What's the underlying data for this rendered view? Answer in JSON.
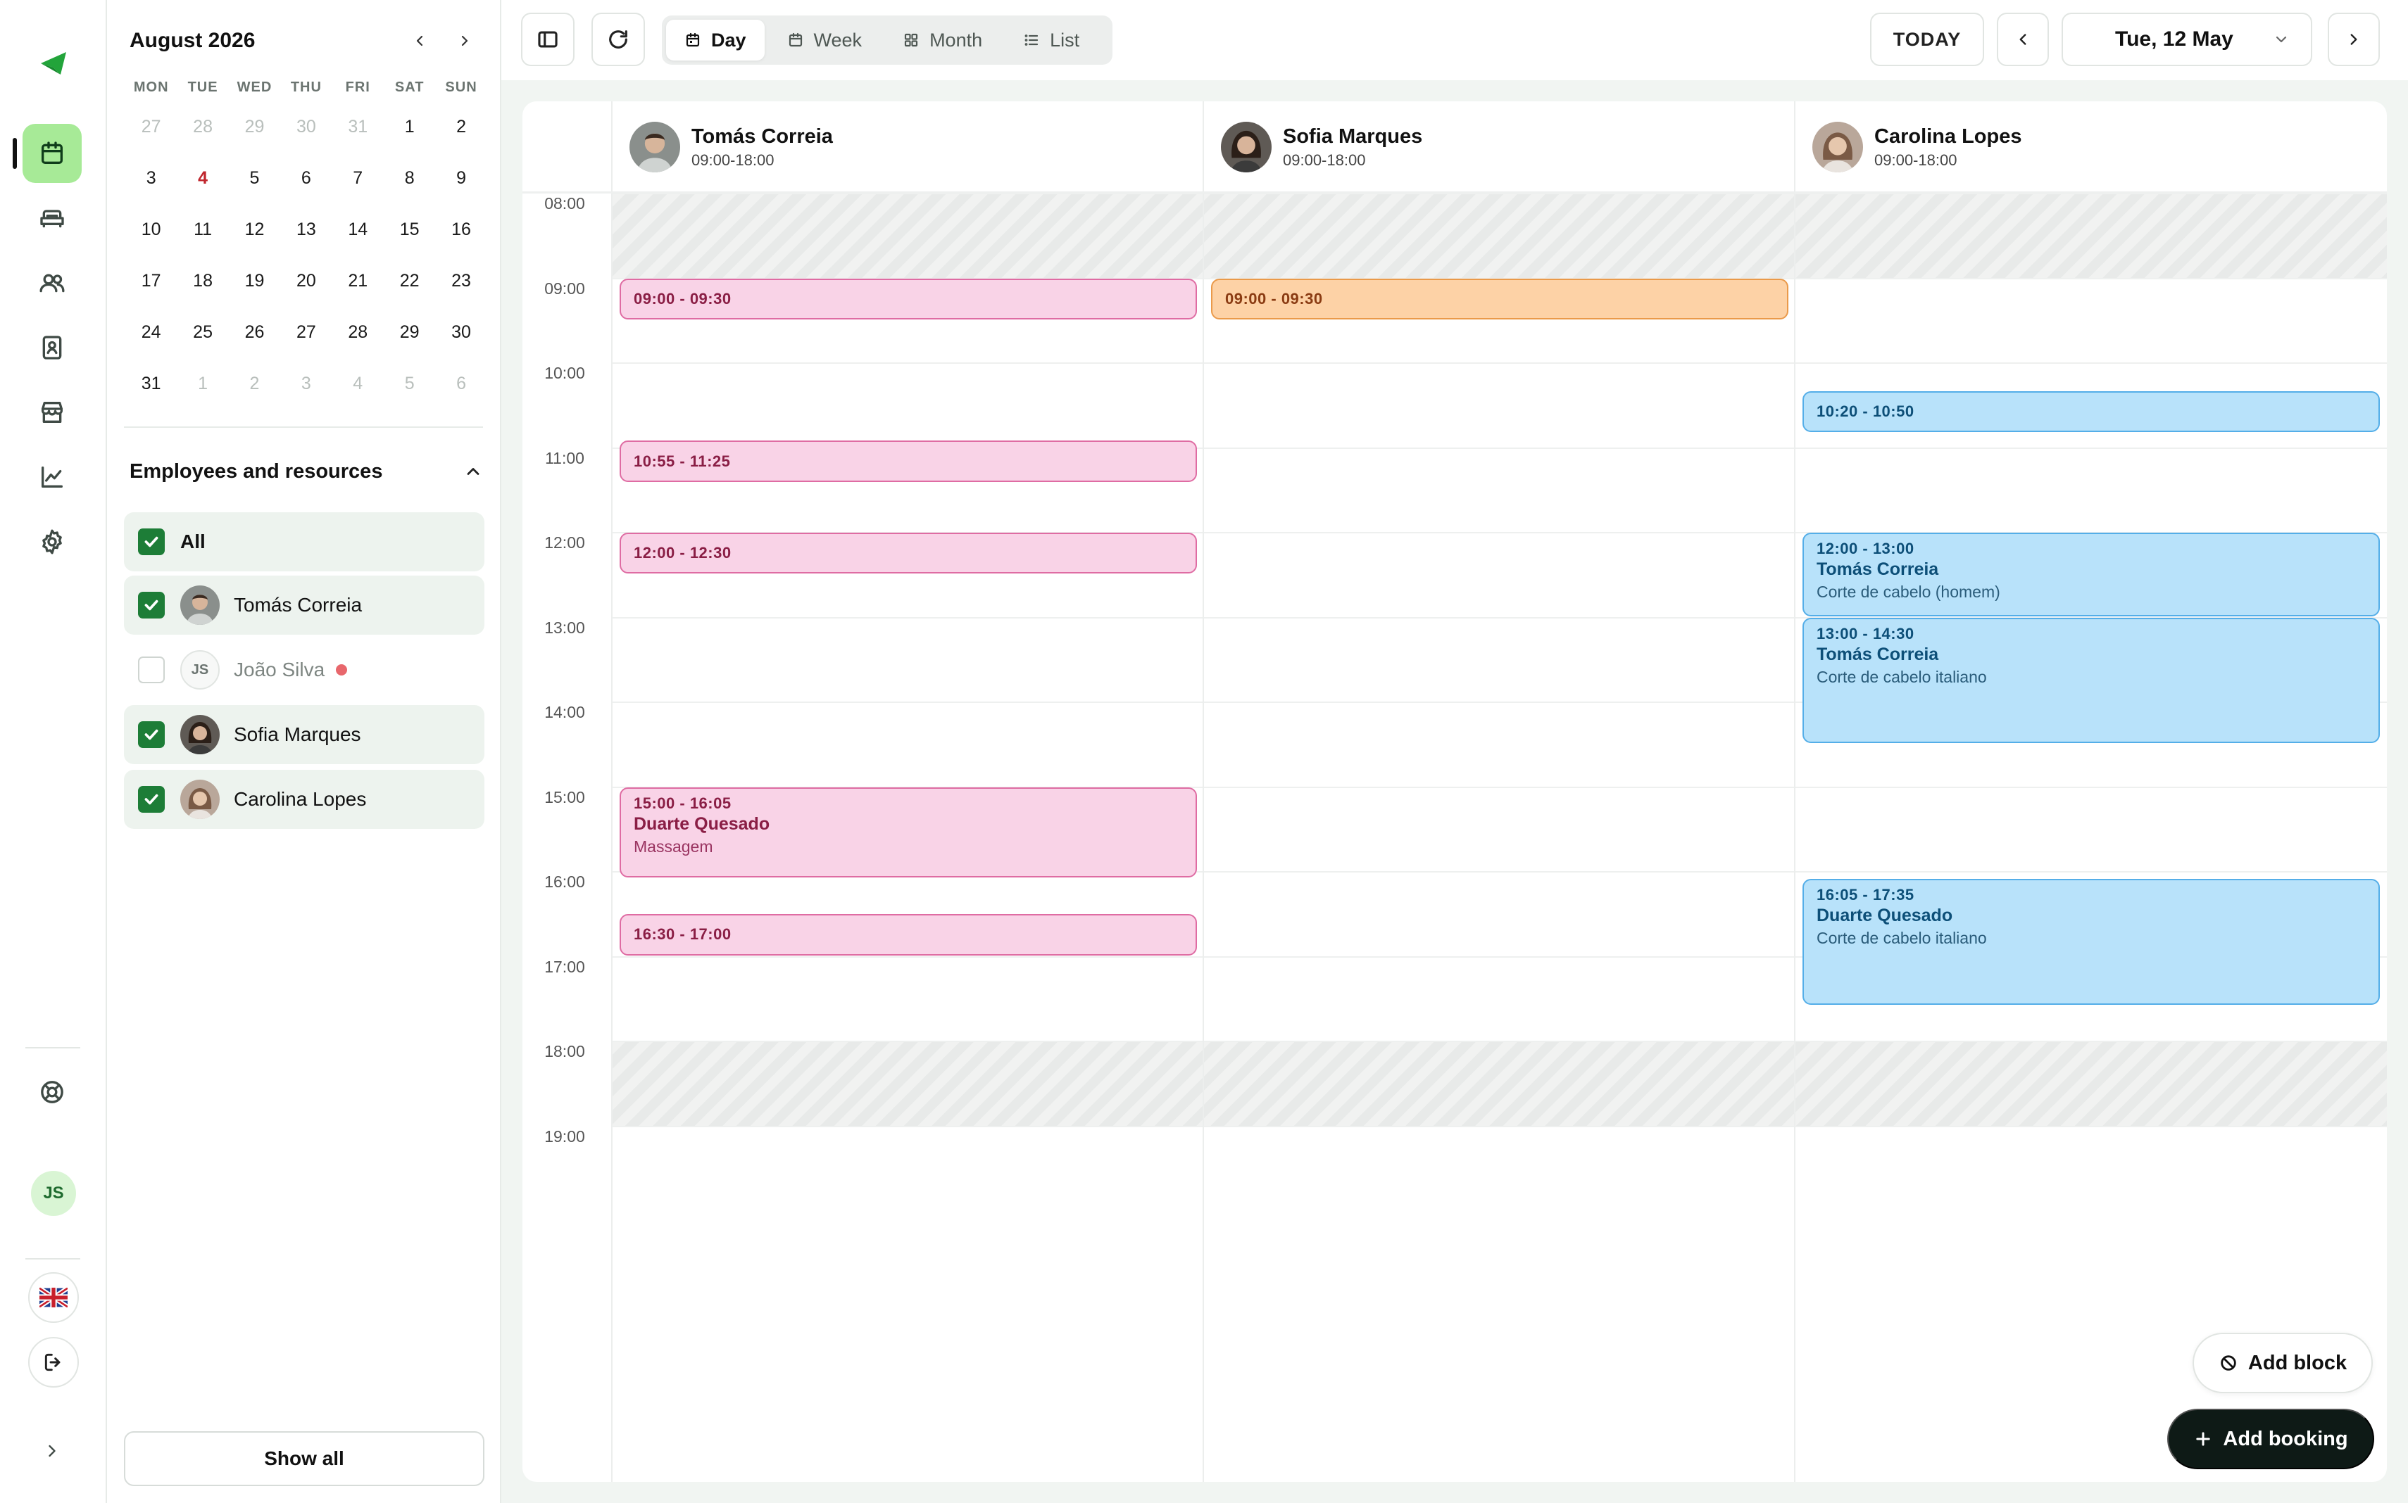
{
  "colors": {
    "accent": "#a7ea97",
    "brand_green": "#1d7d37",
    "pink_event": "#f9d3e7",
    "orange_event": "#fdd2a6",
    "blue_event": "#b8e2fa"
  },
  "rail": {
    "items": [
      {
        "name": "calendar-icon"
      },
      {
        "name": "sofa-icon"
      },
      {
        "name": "users-icon"
      },
      {
        "name": "contacts-icon"
      },
      {
        "name": "store-icon"
      },
      {
        "name": "chart-icon"
      },
      {
        "name": "gear-icon"
      }
    ],
    "user_initials": "JS"
  },
  "mini_calendar": {
    "title": "August 2026",
    "weekdays": [
      "MON",
      "TUE",
      "WED",
      "THU",
      "FRI",
      "SAT",
      "SUN"
    ],
    "days": [
      {
        "d": "27",
        "m": true
      },
      {
        "d": "28",
        "m": true
      },
      {
        "d": "29",
        "m": true
      },
      {
        "d": "30",
        "m": true
      },
      {
        "d": "31",
        "m": true
      },
      {
        "d": "1"
      },
      {
        "d": "2"
      },
      {
        "d": "3"
      },
      {
        "d": "4",
        "t": true
      },
      {
        "d": "5"
      },
      {
        "d": "6"
      },
      {
        "d": "7"
      },
      {
        "d": "8"
      },
      {
        "d": "9"
      },
      {
        "d": "10"
      },
      {
        "d": "11"
      },
      {
        "d": "12"
      },
      {
        "d": "13"
      },
      {
        "d": "14"
      },
      {
        "d": "15"
      },
      {
        "d": "16"
      },
      {
        "d": "17"
      },
      {
        "d": "18"
      },
      {
        "d": "19"
      },
      {
        "d": "20"
      },
      {
        "d": "21"
      },
      {
        "d": "22"
      },
      {
        "d": "23"
      },
      {
        "d": "24"
      },
      {
        "d": "25"
      },
      {
        "d": "26"
      },
      {
        "d": "27"
      },
      {
        "d": "28"
      },
      {
        "d": "29"
      },
      {
        "d": "30"
      },
      {
        "d": "31"
      },
      {
        "d": "1",
        "m": true
      },
      {
        "d": "2",
        "m": true
      },
      {
        "d": "3",
        "m": true
      },
      {
        "d": "4",
        "m": true
      },
      {
        "d": "5",
        "m": true
      },
      {
        "d": "6",
        "m": true
      }
    ]
  },
  "employees": {
    "header": "Employees and resources",
    "all_label": "All",
    "list": [
      {
        "name": "Tomás Correia",
        "checked": true
      },
      {
        "name": "João Silva",
        "checked": false,
        "initials": "JS"
      },
      {
        "name": "Sofia Marques",
        "checked": true
      },
      {
        "name": "Carolina Lopes",
        "checked": true
      }
    ],
    "show_all": "Show all"
  },
  "toolbar": {
    "views": [
      "Day",
      "Week",
      "Month",
      "List"
    ],
    "active_view": "Day",
    "today": "TODAY",
    "date": "Tue, 12 May"
  },
  "schedule": {
    "hours": [
      "08:00",
      "09:00",
      "10:00",
      "11:00",
      "12:00",
      "13:00",
      "14:00",
      "15:00",
      "16:00",
      "17:00",
      "18:00",
      "19:00"
    ],
    "columns": [
      {
        "name": "Tomás Correia",
        "hours": "09:00-18:00"
      },
      {
        "name": "Sofia Marques",
        "hours": "09:00-18:00"
      },
      {
        "name": "Carolina Lopes",
        "hours": "09:00-18:00"
      }
    ],
    "events": [
      {
        "col": 0,
        "start": 9.0,
        "end": 9.5,
        "time": "09:00 - 09:30",
        "color": "pink"
      },
      {
        "col": 0,
        "start": 10.9167,
        "end": 11.4167,
        "time": "10:55 - 11:25",
        "color": "pink"
      },
      {
        "col": 0,
        "start": 12.0,
        "end": 12.5,
        "time": "12:00 - 12:30",
        "color": "pink"
      },
      {
        "col": 0,
        "start": 15.0,
        "end": 16.0833,
        "time": "15:00 - 16:05",
        "client": "Duarte Quesado",
        "service": "Massagem",
        "color": "pink"
      },
      {
        "col": 0,
        "start": 16.5,
        "end": 17.0,
        "time": "16:30 - 17:00",
        "color": "pink"
      },
      {
        "col": 1,
        "start": 9.0,
        "end": 9.5,
        "time": "09:00 - 09:30",
        "color": "orange"
      },
      {
        "col": 2,
        "start": 10.3333,
        "end": 10.8333,
        "time": "10:20 - 10:50",
        "color": "blue"
      },
      {
        "col": 2,
        "start": 12.0,
        "end": 13.0,
        "time": "12:00 - 13:00",
        "client": "Tomás Correia",
        "service": "Corte de cabelo (homem)",
        "color": "blue"
      },
      {
        "col": 2,
        "start": 13.0,
        "end": 14.5,
        "time": "13:00 - 14:30",
        "client": "Tomás Correia",
        "service": "Corte de cabelo italiano",
        "color": "blue"
      },
      {
        "col": 2,
        "start": 16.0833,
        "end": 17.5833,
        "time": "16:05 - 17:35",
        "client": "Duarte Quesado",
        "service": "Corte de cabelo italiano",
        "color": "blue"
      }
    ]
  },
  "actions": {
    "add_block": "Add block",
    "add_booking": "Add booking"
  }
}
